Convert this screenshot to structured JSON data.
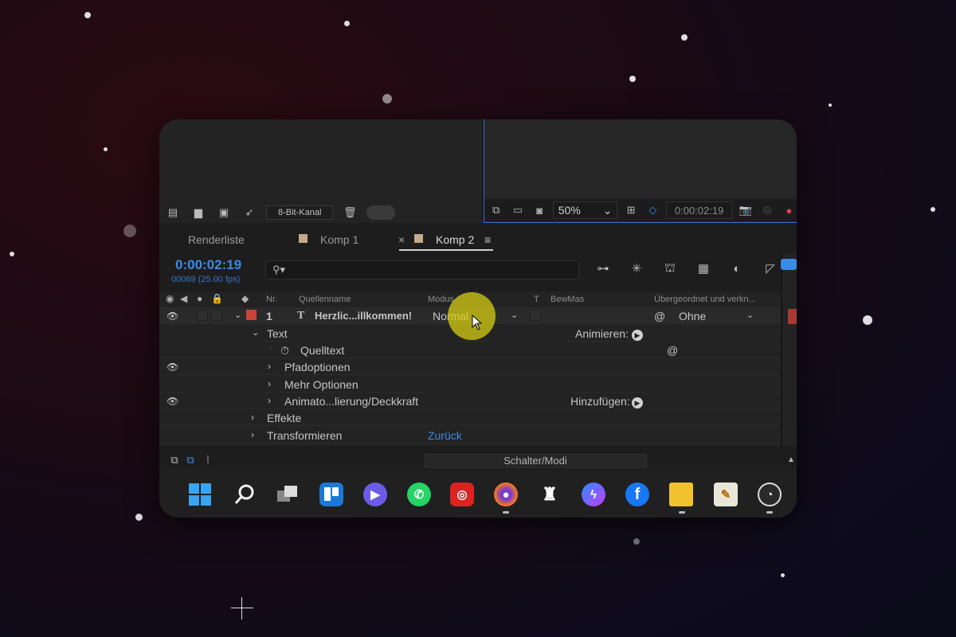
{
  "project_panel": {
    "bit_depth": "8-Bit-Kanal"
  },
  "viewer": {
    "zoom": "50%",
    "timecode": "0:00:02:19"
  },
  "tabs": [
    {
      "label": "Renderliste",
      "active": false
    },
    {
      "label": "Komp 1",
      "active": false
    },
    {
      "label": "Komp 2",
      "active": true
    }
  ],
  "timeline": {
    "current_time": "0:00:02:19",
    "frames": "00069 (25.00 fps)",
    "search_placeholder": "",
    "search_icon_glyph": "⚲▾"
  },
  "columns": {
    "nr": "Nr.",
    "source_name": "Quellenname",
    "mode": "Modus",
    "t": "T",
    "track_matte": "BewMas",
    "parent": "Übergeordnet und verkn..."
  },
  "layer": {
    "number": "1",
    "type_glyph": "T",
    "name": "Herzlic...illkommen!",
    "mode": "Normal",
    "parent": "Ohne",
    "label_color": "#c8443a"
  },
  "properties": {
    "text": "Text",
    "animate_label": "Animieren:",
    "source_text": "Quelltext",
    "path_options": "Pfadoptionen",
    "more_options": "Mehr Optionen",
    "animator": "Animato...lierung/Deckkraft",
    "add_label": "Hinzufügen:",
    "effects": "Effekte",
    "transform": "Transformieren",
    "reset": "Zurück"
  },
  "footer": {
    "switches_modes": "Schalter/Modi"
  },
  "colors": {
    "accent_blue": "#3a8ae8",
    "cursor_highlight": "#d7cd14"
  }
}
